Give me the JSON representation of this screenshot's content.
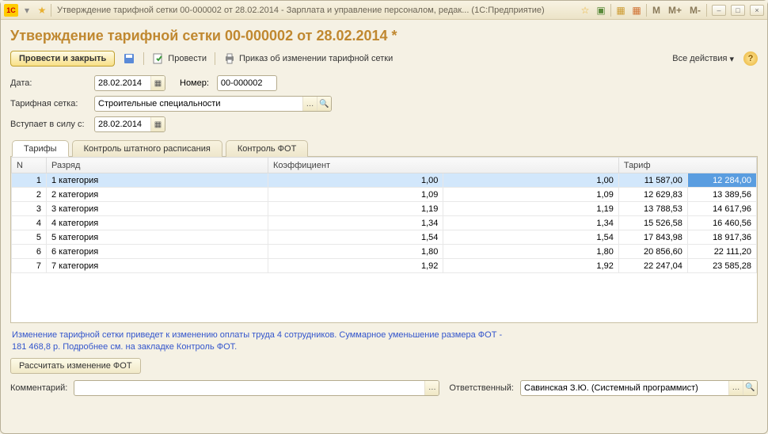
{
  "titlebar": {
    "title": "Утверждение тарифной сетки 00-000002 от 28.02.2014 - Зарплата и управление персоналом, редак... (1С:Предприятие)",
    "m": "M",
    "mplus": "M+",
    "mminus": "M-"
  },
  "page": {
    "title": "Утверждение тарифной сетки 00-000002 от 28.02.2014 *"
  },
  "toolbar": {
    "submit_close": "Провести и закрыть",
    "submit": "Провести",
    "order": "Приказ об изменении тарифной сетки",
    "all_actions": "Все действия"
  },
  "form": {
    "date_label": "Дата:",
    "date_value": "28.02.2014",
    "number_label": "Номер:",
    "number_value": "00-000002",
    "grid_label": "Тарифная сетка:",
    "grid_value": "Строительные специальности",
    "effective_label": "Вступает в силу с:",
    "effective_value": "28.02.2014"
  },
  "tabs": {
    "t1": "Тарифы",
    "t2": "Контроль штатного расписания",
    "t3": "Контроль ФОТ"
  },
  "table": {
    "h_n": "N",
    "h_razryad": "Разряд",
    "h_coef": "Коэффициент",
    "h_tarif": "Тариф",
    "rows": [
      {
        "n": "1",
        "razryad": "1 категория",
        "c1": "1,00",
        "c2": "1,00",
        "t1": "11 587,00",
        "t2": "12 284,00"
      },
      {
        "n": "2",
        "razryad": "2 категория",
        "c1": "1,09",
        "c2": "1,09",
        "t1": "12 629,83",
        "t2": "13 389,56"
      },
      {
        "n": "3",
        "razryad": "3 категория",
        "c1": "1,19",
        "c2": "1,19",
        "t1": "13 788,53",
        "t2": "14 617,96"
      },
      {
        "n": "4",
        "razryad": "4 категория",
        "c1": "1,34",
        "c2": "1,34",
        "t1": "15 526,58",
        "t2": "16 460,56"
      },
      {
        "n": "5",
        "razryad": "5 категория",
        "c1": "1,54",
        "c2": "1,54",
        "t1": "17 843,98",
        "t2": "18 917,36"
      },
      {
        "n": "6",
        "razryad": "6 категория",
        "c1": "1,80",
        "c2": "1,80",
        "t1": "20 856,60",
        "t2": "22 111,20"
      },
      {
        "n": "7",
        "razryad": "7 категория",
        "c1": "1,92",
        "c2": "1,92",
        "t1": "22 247,04",
        "t2": "23 585,28"
      }
    ]
  },
  "info": "Изменение тарифной сетки приведет к изменению оплаты труда 4 сотрудников. Суммарное уменьшение размера ФОТ - 181 468,8 р. Подробнее см. на закладке Контроль ФОТ.",
  "buttons": {
    "recalc": "Рассчитать изменение ФОТ"
  },
  "bottom": {
    "comment_label": "Комментарий:",
    "comment_value": "",
    "responsible_label": "Ответственный:",
    "responsible_value": "Савинская З.Ю. (Системный программист)"
  },
  "colors": {
    "accent": "#c08830"
  }
}
